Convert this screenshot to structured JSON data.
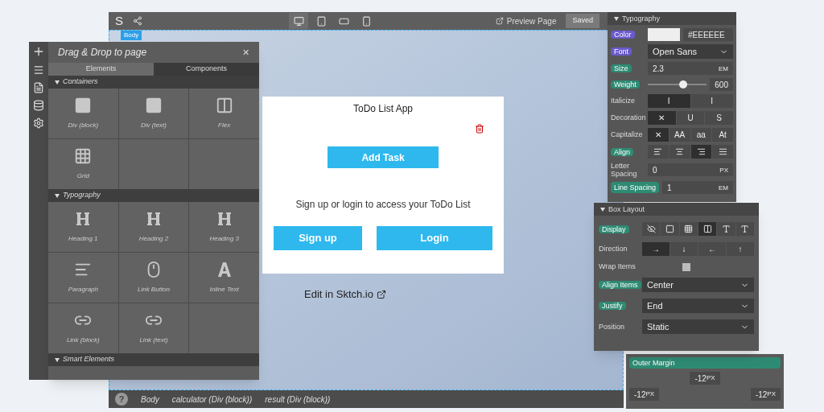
{
  "toolbar": {
    "logo": "S",
    "devices": [
      {
        "kind": "desktop",
        "selected": true
      },
      {
        "kind": "tablet",
        "selected": false
      },
      {
        "kind": "landscape",
        "selected": false
      },
      {
        "kind": "phone",
        "selected": false
      }
    ],
    "preview": "Preview Page",
    "saved": "Saved"
  },
  "canvas": {
    "tag": "Body",
    "app_title": "ToDo List App",
    "add_task": "Add Task",
    "message": "Sign up or login to access your ToDo List",
    "signup": "Sign up",
    "login": "Login",
    "edit_link": "Edit in Sktch.io"
  },
  "elements_panel": {
    "title": "Drag & Drop to page",
    "close": "✕",
    "tabs": [
      {
        "label": "Elements",
        "selected": false
      },
      {
        "label": "Components",
        "selected": true
      }
    ],
    "sections": [
      {
        "title": "Containers",
        "items": [
          {
            "label": "Div (block)",
            "kind": "square"
          },
          {
            "label": "Div (text)",
            "kind": "square"
          },
          {
            "label": "Flex",
            "kind": "flex"
          },
          {
            "label": "Grid",
            "kind": "grid"
          }
        ]
      },
      {
        "title": "Typography",
        "items": [
          {
            "label": "Heading 1",
            "kind": "heading"
          },
          {
            "label": "Heading 2",
            "kind": "heading"
          },
          {
            "label": "Heading 3",
            "kind": "heading"
          },
          {
            "label": "Paragraph",
            "kind": "paragraph"
          },
          {
            "label": "Link Button",
            "kind": "mouse"
          },
          {
            "label": "Inline Text",
            "kind": "letter"
          },
          {
            "label": "Link (block)",
            "kind": "link"
          },
          {
            "label": "Link (text)",
            "kind": "link"
          }
        ]
      },
      {
        "title": "Smart Elements"
      }
    ]
  },
  "typography": {
    "title": "Typography",
    "color": {
      "label": "Color",
      "color": "#6a5acd",
      "value": "#EEEEEE"
    },
    "font": {
      "label": "Font",
      "color": "#6a5acd",
      "value": "Open Sans"
    },
    "size": {
      "label": "Size",
      "color": "#2e8b73",
      "value": "2.3",
      "unit": "EM"
    },
    "weight": {
      "label": "Weight",
      "color": "#2e8b73",
      "level": 0.6,
      "value": "600"
    },
    "italicize": {
      "label": "Italicize",
      "options": [
        {
          "label": "I",
          "selected": true
        },
        {
          "label": "I",
          "selected": false
        }
      ]
    },
    "decoration": {
      "label": "Decoration",
      "options": [
        {
          "label": "✕",
          "selected": true
        },
        {
          "label": "U",
          "selected": false
        },
        {
          "label": "S",
          "selected": false
        }
      ]
    },
    "capitalize": {
      "label": "Capitalize",
      "options": [
        {
          "label": "✕",
          "selected": true
        },
        {
          "label": "AA",
          "selected": false
        },
        {
          "label": "aa",
          "selected": false
        },
        {
          "label": "At",
          "selected": false
        }
      ]
    },
    "align": {
      "label": "Align",
      "color": "#2e8b73",
      "options": [
        {
          "kind": "left",
          "selected": false
        },
        {
          "kind": "center",
          "selected": false
        },
        {
          "kind": "right",
          "selected": true
        },
        {
          "kind": "justify",
          "selected": false
        }
      ]
    },
    "letter_spacing": {
      "label": "Letter Spacing",
      "value": "0",
      "unit": "PX"
    },
    "line_spacing": {
      "label": "Line Spacing",
      "color": "#2e8b73",
      "value": "1",
      "unit": "EM"
    }
  },
  "box_layout": {
    "title": "Box Layout",
    "display": {
      "label": "Display",
      "color": "#2e8b73",
      "options": [
        {
          "kind": "hidden",
          "selected": false
        },
        {
          "kind": "block",
          "selected": false
        },
        {
          "kind": "grid",
          "selected": false
        },
        {
          "kind": "flex",
          "selected": true
        },
        {
          "kind": "inline-block",
          "selected": false
        },
        {
          "kind": "inline",
          "selected": false
        }
      ]
    },
    "direction": {
      "label": "Direction",
      "options": [
        {
          "label": "→",
          "selected": true
        },
        {
          "label": "↓",
          "selected": false
        },
        {
          "label": "←",
          "selected": false
        },
        {
          "label": "↑",
          "selected": false
        }
      ]
    },
    "wrap": {
      "label": "Wrap Items",
      "checked": false
    },
    "align_items": {
      "label": "Align Items",
      "color": "#2e8b73",
      "value": "Center"
    },
    "justify": {
      "label": "Justify",
      "color": "#2e8b73",
      "value": "End"
    },
    "position": {
      "label": "Position",
      "value": "Static"
    }
  },
  "margin_panel": {
    "label": "Outer Margin",
    "color": "#2e8b73",
    "fields": [
      {
        "value": "-12",
        "unit": "PX"
      },
      {
        "value": "-12",
        "unit": "PX"
      },
      {
        "value": "-12",
        "unit": "PX"
      }
    ]
  },
  "status_bar": {
    "help": "?",
    "crumbs": [
      "Body",
      "calculator (Div (block))",
      "result (Div (block))"
    ]
  }
}
